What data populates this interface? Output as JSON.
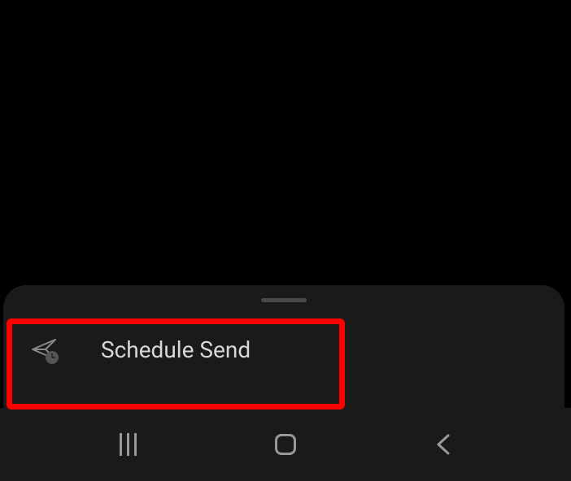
{
  "menu": {
    "schedule_send_label": "Schedule Send"
  },
  "icons": {
    "schedule_send": "plane-clock-icon",
    "nav_recents": "recents-icon",
    "nav_home": "home-icon",
    "nav_back": "back-icon"
  }
}
